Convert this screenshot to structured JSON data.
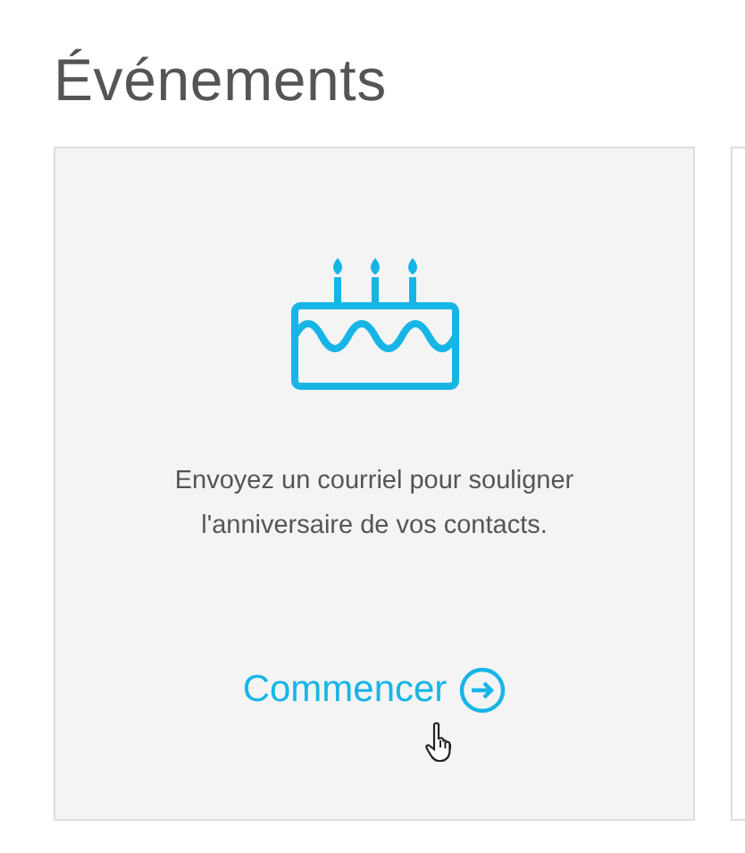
{
  "heading": "Événements",
  "cards": [
    {
      "kind": "event",
      "description": "Envoyez un courriel pour souligner l'anniversaire de vos contacts.",
      "action": "Commencer"
    },
    {
      "kind": "empty"
    }
  ]
}
